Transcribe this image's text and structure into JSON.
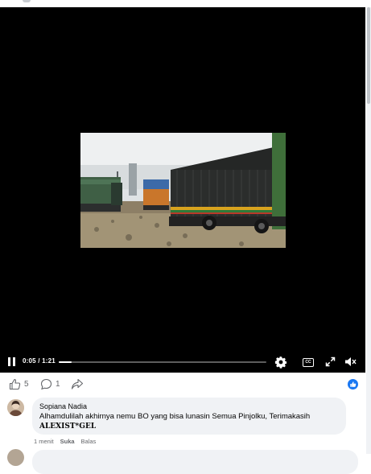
{
  "player": {
    "time_current": "0:05",
    "time_total": "1:21",
    "progress_fraction": 0.062,
    "cc_label": "CC"
  },
  "reactions": {
    "like_count": "5",
    "comment_count": "1"
  },
  "comment": {
    "author": "Sopiana Nadia",
    "text": "Alhamdulilah akhirnya nemu BO yang bisa lunasin Semua Pinjolku, Terimakasih",
    "tag": "ALEXIST*GEL",
    "time": "1 menit",
    "like_label": "Suka",
    "reply_label": "Balas"
  },
  "colors": {
    "accent": "#1877f2",
    "player_bg": "#000000",
    "bubble_bg": "#f0f2f5",
    "meta_text": "#65676b"
  }
}
